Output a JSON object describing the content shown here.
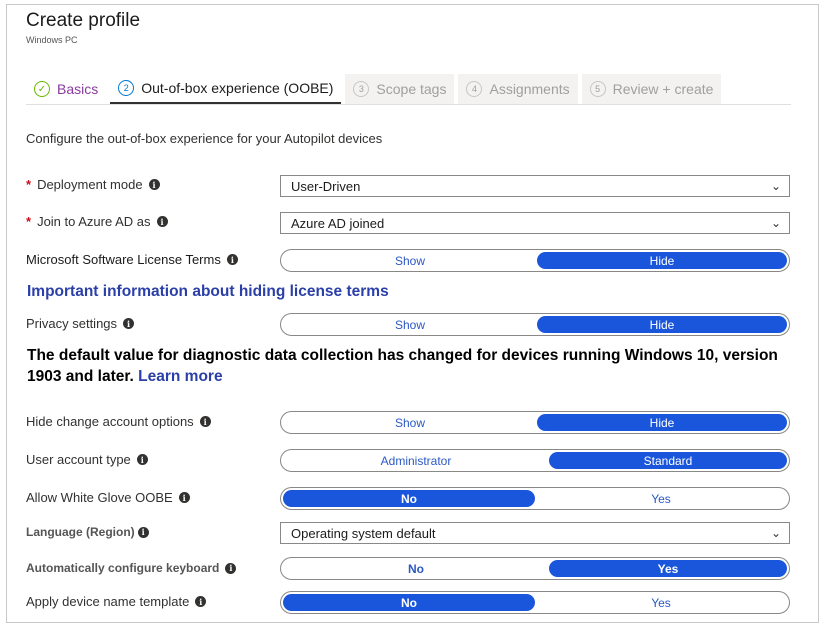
{
  "header": {
    "title": "Create profile",
    "subtitle": "Windows PC"
  },
  "tabs": [
    {
      "marker": "✓",
      "label": "Basics",
      "state": "done"
    },
    {
      "marker": "2",
      "label": "Out-of-box experience (OOBE)",
      "state": "active"
    },
    {
      "marker": "3",
      "label": "Scope tags",
      "state": "disabled"
    },
    {
      "marker": "4",
      "label": "Assignments",
      "state": "disabled"
    },
    {
      "marker": "5",
      "label": "Review + create",
      "state": "disabled"
    }
  ],
  "intro": "Configure the out-of-box experience for your Autopilot devices",
  "fields": {
    "deployment_mode": {
      "label": "Deployment mode",
      "value": "User-Driven"
    },
    "join_azure": {
      "label": "Join to Azure AD as",
      "value": "Azure AD joined"
    },
    "license_terms": {
      "label": "Microsoft Software License Terms",
      "left": "Show",
      "right": "Hide",
      "selected": "right"
    },
    "privacy": {
      "label": "Privacy settings",
      "left": "Show",
      "right": "Hide",
      "selected": "right"
    },
    "hide_change_account": {
      "label": "Hide change account options",
      "left": "Show",
      "right": "Hide",
      "selected": "right"
    },
    "user_account_type": {
      "label": "User account type",
      "left": "Administrator",
      "right": "Standard",
      "selected": "right"
    },
    "white_glove": {
      "label": "Allow White Glove OOBE",
      "left": "No",
      "right": "Yes",
      "selected": "left"
    },
    "language": {
      "label": "Language (Region)",
      "value": "Operating system default"
    },
    "auto_keyboard": {
      "label": "Automatically configure keyboard",
      "left": "No",
      "right": "Yes",
      "selected": "right"
    },
    "device_name": {
      "label": "Apply device name template",
      "left": "No",
      "right": "Yes",
      "selected": "left"
    }
  },
  "license_link": "Important information about hiding license terms",
  "notice": {
    "text": "The default value for diagnostic data collection has changed for devices running Windows 10, version 1903 and later.",
    "link": "Learn more"
  },
  "icons": {
    "info": "i",
    "chevron": "⌄"
  },
  "colors": {
    "accent": "#1a56db",
    "link": "#2b3fa8",
    "required": "#c50f1f",
    "done": "#6bb700"
  }
}
